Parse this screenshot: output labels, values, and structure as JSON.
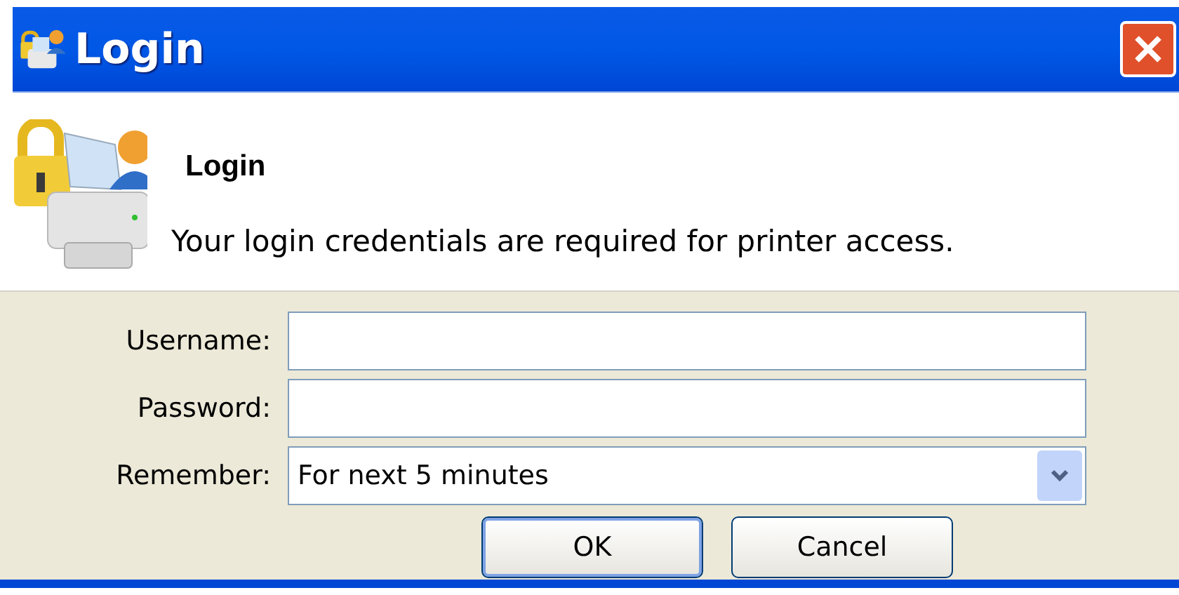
{
  "window": {
    "title": "Login"
  },
  "header": {
    "title": "Login",
    "message": "Your login credentials are required for printer access."
  },
  "fields": [
    {
      "kind": "text",
      "label": "Username:"
    },
    {
      "kind": "password",
      "label": "Password:"
    },
    {
      "kind": "dropdown",
      "label": "Remember:",
      "value": "For next 5 minutes"
    }
  ],
  "buttons": [
    {
      "label": "OK",
      "default": true
    },
    {
      "label": "Cancel",
      "default": false
    }
  ]
}
